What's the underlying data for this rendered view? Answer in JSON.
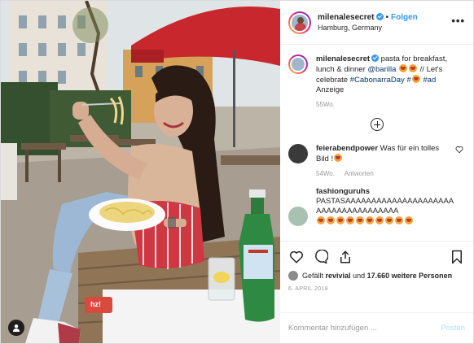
{
  "header": {
    "username": "milenalesecret",
    "separator": "•",
    "follow_label": "Folgen",
    "location": "Hamburg, Germany",
    "more_label": "•••"
  },
  "caption": {
    "username": "milenalesecret",
    "text_1": "pasta for breakfast, lunch & dinner",
    "mention": "@barilla",
    "text_2": "// Let's celebrate",
    "hashtag_1": "#CabonarraDay",
    "hashtag_2": "#",
    "hashtag_3": "#ad",
    "line_2": "Anzeige",
    "time": "55Wo."
  },
  "comments": [
    {
      "username": "feierabendpower",
      "text": "Was für ein tolles Bild !",
      "time": "54Wo.",
      "reply_label": "Antworten"
    },
    {
      "username": "fashionguruhs",
      "text": "PASTASAAAAAAAAAAAAAAAAAAAAAAAAAAAAAAAAAAAAA"
    }
  ],
  "likes": {
    "prefix": "Gefällt",
    "user": "revivial",
    "middle": "und",
    "count_text": "17.660 weitere Personen"
  },
  "date": "6. APRIL 2018",
  "comment_input": {
    "placeholder": "Kommentar hinzufügen ...",
    "post_label": "Posten"
  },
  "photo": {
    "sign_text": "hz!"
  },
  "colors": {
    "link": "#3897f0",
    "hashtag": "#003569",
    "umbrella": "#c8282d",
    "post_disabled": "#b2dffc"
  },
  "icons": [
    "verified-icon",
    "more-icon",
    "heart-icon",
    "comment-icon",
    "share-icon",
    "bookmark-icon",
    "plus-circle-icon",
    "user-tag-icon"
  ]
}
